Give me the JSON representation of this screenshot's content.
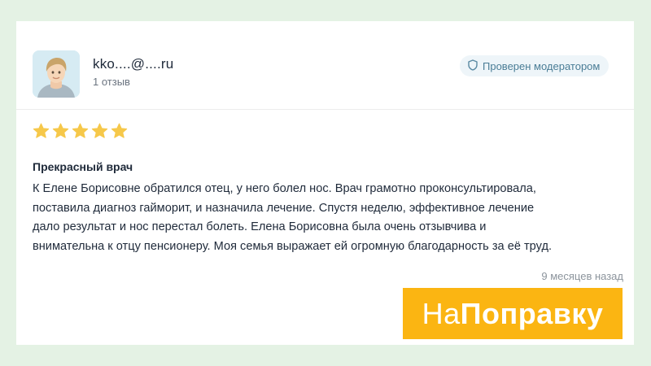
{
  "reviewer": {
    "username": "kko....@....ru",
    "review_count": "1 отзыв",
    "avatar_icon": "user-avatar-icon"
  },
  "badge": {
    "label": "Проверен модератором",
    "icon": "shield-icon"
  },
  "rating": {
    "stars": 5,
    "max": 5,
    "color": "#f6c84a"
  },
  "review": {
    "title": "Прекрасный врач",
    "lines": [
      "К Елене Борисовне обратился отец, у него болел нос. Врач грамотно проконсультировала,",
      "поставила диагноз гайморит, и назначила лечение. Спустя неделю, эффективное лечение",
      "дало результат и нос перестал болеть. Елена Борисовна была очень отзывчива и",
      "внимательна к отцу пенсионеру. Моя семья выражает ей огромную благодарность за её труд."
    ],
    "date": "9 месяцев назад"
  },
  "logo": {
    "part1": "На",
    "part2": "Поправку",
    "color": "#fbb512"
  }
}
